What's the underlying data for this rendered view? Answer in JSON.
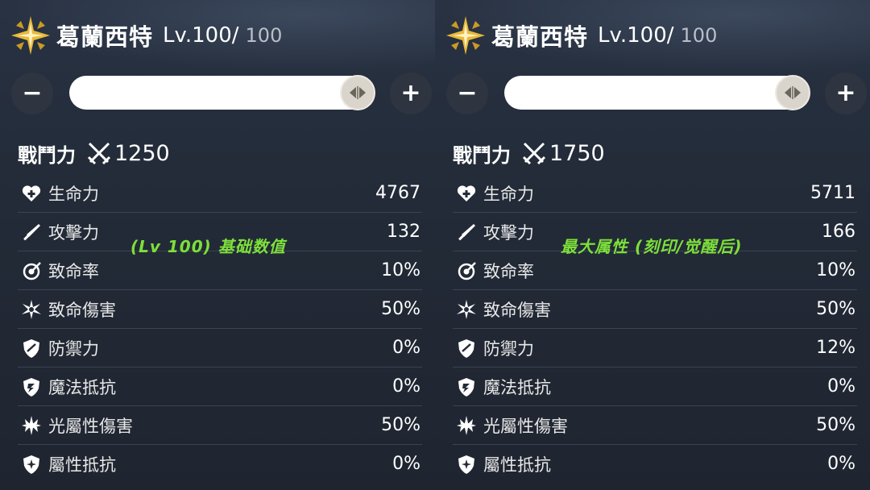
{
  "panels": [
    {
      "character_name": "葛蘭西特",
      "level": "Lv.100/",
      "level_max": "100",
      "combat_power_label": "戰鬥力",
      "combat_power_value": "1250",
      "overlay_note": "(Lv 100) 基础数值",
      "stats": [
        {
          "icon": "heart-plus-icon",
          "label": "生命力",
          "value": "4767"
        },
        {
          "icon": "sword-icon",
          "label": "攻擊力",
          "value": "132"
        },
        {
          "icon": "crit-target-icon",
          "label": "致命率",
          "value": "10%"
        },
        {
          "icon": "burst-icon",
          "label": "致命傷害",
          "value": "50%"
        },
        {
          "icon": "shield-icon",
          "label": "防禦力",
          "value": "0%"
        },
        {
          "icon": "magic-shield-icon",
          "label": "魔法抵抗",
          "value": "0%"
        },
        {
          "icon": "light-star-icon",
          "label": "光屬性傷害",
          "value": "50%"
        },
        {
          "icon": "element-shield-icon",
          "label": "屬性抵抗",
          "value": "0%"
        }
      ]
    },
    {
      "character_name": "葛蘭西特",
      "level": "Lv.100/",
      "level_max": "100",
      "combat_power_label": "戰鬥力",
      "combat_power_value": "1750",
      "overlay_note": "最大属性 (刻印/觉醒后)",
      "stats": [
        {
          "icon": "heart-plus-icon",
          "label": "生命力",
          "value": "5711"
        },
        {
          "icon": "sword-icon",
          "label": "攻擊力",
          "value": "166"
        },
        {
          "icon": "crit-target-icon",
          "label": "致命率",
          "value": "10%"
        },
        {
          "icon": "burst-icon",
          "label": "致命傷害",
          "value": "50%"
        },
        {
          "icon": "shield-icon",
          "label": "防禦力",
          "value": "12%"
        },
        {
          "icon": "magic-shield-icon",
          "label": "魔法抵抗",
          "value": "0%"
        },
        {
          "icon": "light-star-icon",
          "label": "光屬性傷害",
          "value": "50%"
        },
        {
          "icon": "element-shield-icon",
          "label": "屬性抵抗",
          "value": "0%"
        }
      ]
    }
  ],
  "controls": {
    "minus_label": "−",
    "plus_label": "+"
  },
  "level_slider_fraction": 1.0,
  "colors": {
    "overlay_note": "#7de03a",
    "element_gold": "#e8b93a"
  },
  "header_icon": "light-element-star-icon"
}
